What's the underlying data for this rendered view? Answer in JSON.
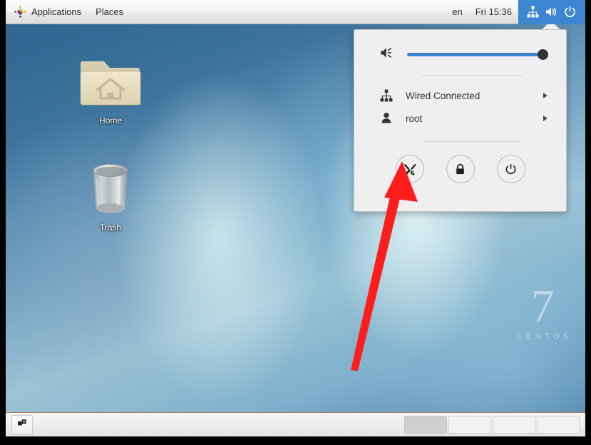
{
  "top_panel": {
    "logo_icon": "centos-logo-icon",
    "menus": [
      {
        "label": "Applications"
      },
      {
        "label": "Places"
      }
    ],
    "keyboard_layout": "en",
    "clock": "Fri 15:36",
    "status_area": {
      "active": true,
      "accent_color": "#3c85d0",
      "icons": [
        "network-wired-icon",
        "volume-icon",
        "power-icon"
      ]
    }
  },
  "desktop": {
    "icons": [
      {
        "label": "Home",
        "icon": "home-folder-icon"
      },
      {
        "label": "Trash",
        "icon": "trash-can-icon"
      }
    ],
    "watermark": {
      "version": "7",
      "name": "CENTOS"
    }
  },
  "system_menu": {
    "volume": {
      "icon": "volume-icon",
      "value": 100,
      "track_color": "#3c85d0",
      "knob_color": "#333333"
    },
    "rows": [
      {
        "label": "Wired Connected",
        "icon": "network-wired-icon",
        "expander": "chevron-right-icon"
      },
      {
        "label": "root",
        "icon": "user-icon",
        "expander": "chevron-right-icon"
      }
    ],
    "buttons": [
      {
        "name": "settings",
        "icon": "settings-tools-icon"
      },
      {
        "name": "lock",
        "icon": "lock-icon"
      },
      {
        "name": "power",
        "icon": "power-icon"
      }
    ]
  },
  "annotation": {
    "arrow_color": "#fc1d1d",
    "points_to": "settings-button"
  },
  "bottom_panel": {
    "show_desktop_icon": "show-desktop-icon",
    "workspaces": [
      {
        "active": true
      },
      {
        "active": false
      },
      {
        "active": false
      },
      {
        "active": false
      }
    ]
  }
}
